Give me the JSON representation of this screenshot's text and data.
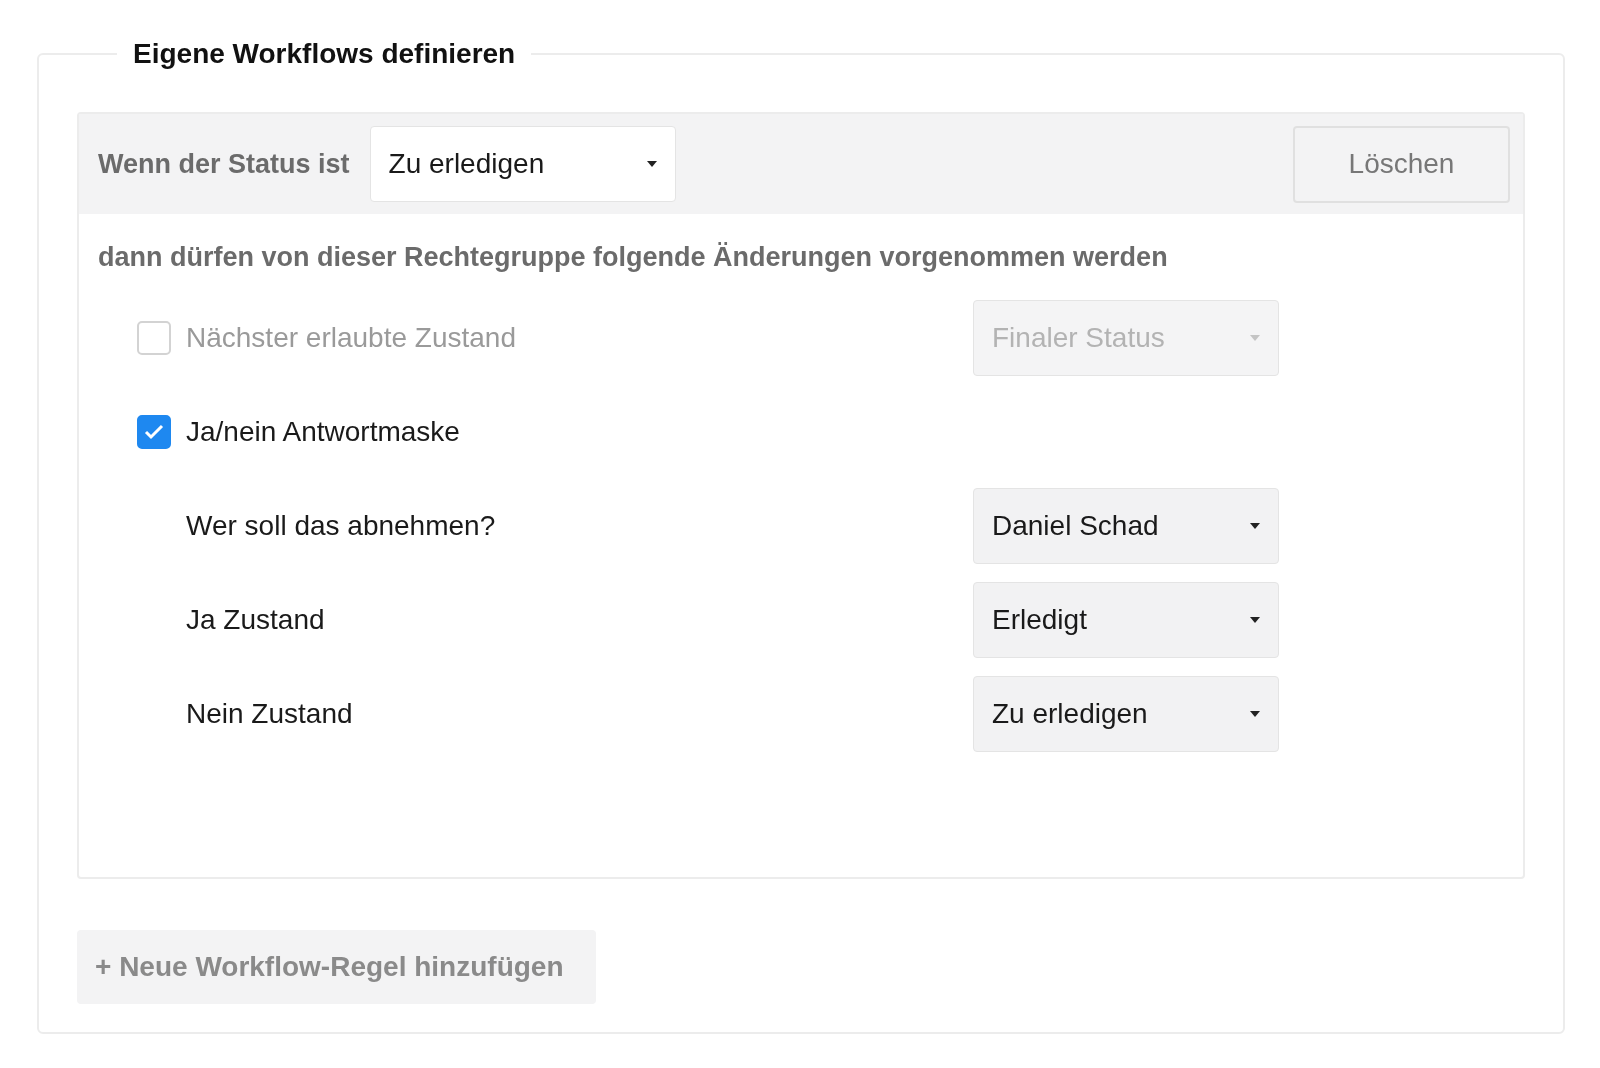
{
  "section": {
    "title": "Eigene Workflows definieren"
  },
  "rule": {
    "condition_label": "Wenn der Status ist",
    "condition_select": {
      "value": "Zu erledigen"
    },
    "delete_button": "Löschen",
    "description": "dann dürfen von dieser Rechtegruppe folgende Änderungen vorgenommen werden",
    "rows": [
      {
        "kind": "checkbox",
        "label": "Nächster erlaubte Zustand",
        "checked": false,
        "select": {
          "value": "Finaler Status",
          "disabled": true
        }
      },
      {
        "kind": "checkbox",
        "label": "Ja/nein Antwortmaske",
        "checked": true
      },
      {
        "kind": "field",
        "label": "Wer soll das abnehmen?",
        "select": {
          "value": "Daniel Schad",
          "disabled": false
        }
      },
      {
        "kind": "field",
        "label": "Ja Zustand",
        "select": {
          "value": "Erledigt",
          "disabled": false
        }
      },
      {
        "kind": "field",
        "label": "Nein Zustand",
        "select": {
          "value": "Zu erledigen",
          "disabled": false
        }
      }
    ]
  },
  "add_button": "+ Neue Workflow-Regel hinzufügen"
}
